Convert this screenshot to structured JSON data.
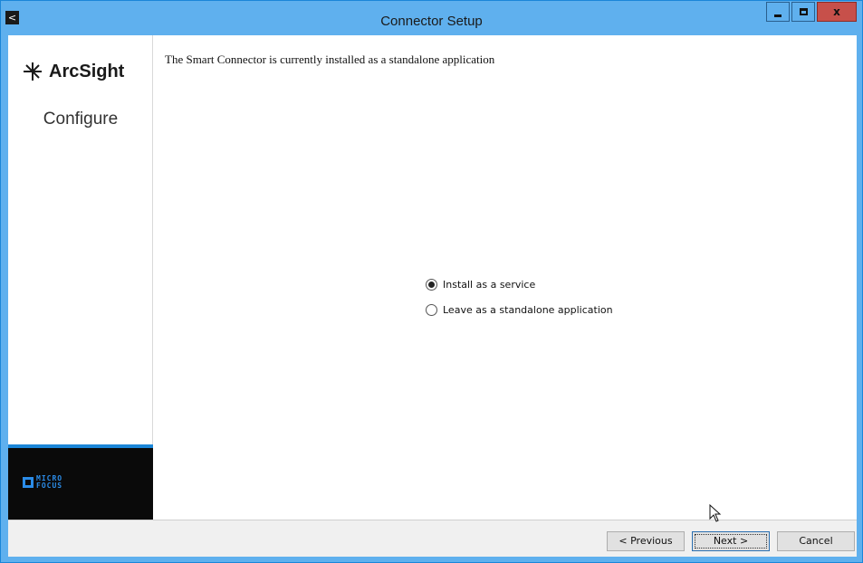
{
  "window": {
    "title": "Connector Setup",
    "icons": {
      "app": "back-arrow-icon",
      "minimize": "minimize-icon",
      "maximize": "maximize-icon",
      "close": "close-icon"
    },
    "close_glyph": "x",
    "app_glyph": "<"
  },
  "sidebar": {
    "brand": "ArcSight",
    "step": "Configure",
    "footer_logo": "MICRO FOCUS",
    "footer_logo_lines": [
      "MICRO",
      "FOCUS"
    ]
  },
  "main": {
    "message": "The Smart Connector is currently installed as a standalone application",
    "options": [
      {
        "label": "Install as a service",
        "selected": true
      },
      {
        "label": "Leave as a standalone application",
        "selected": false
      }
    ]
  },
  "buttons": {
    "previous": "< Previous",
    "next": "Next >",
    "cancel": "Cancel"
  },
  "colors": {
    "titlebar": "#5fb0ee",
    "close": "#c7504a",
    "accent": "#1b86d8",
    "footer_bg": "#0a0a0a"
  }
}
